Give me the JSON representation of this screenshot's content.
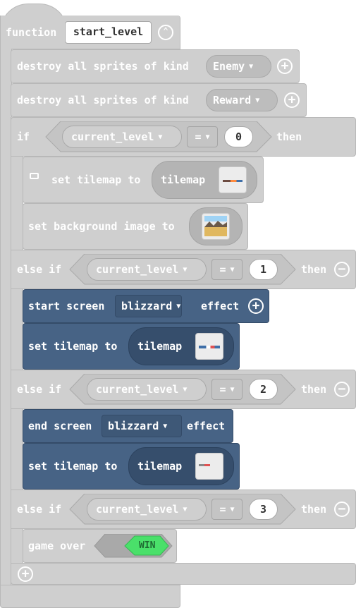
{
  "function": {
    "keyword": "function",
    "name": "start_level",
    "collapse_icon": "chevron-up-icon"
  },
  "destroy_enemy": {
    "label": "destroy all sprites of kind",
    "kind": "Enemy",
    "add_icon": "plus-icon"
  },
  "destroy_reward": {
    "label": "destroy all sprites of kind",
    "kind": "Reward",
    "add_icon": "plus-icon"
  },
  "if_block": {
    "if_label": "if",
    "then_label": "then",
    "else_if_label": "else if",
    "remove_icon": "minus-icon",
    "add_icon": "plus-icon",
    "variable": "current_level",
    "operator": "=",
    "branches": [
      {
        "value": "0"
      },
      {
        "value": "1"
      },
      {
        "value": "2"
      },
      {
        "value": "3"
      }
    ]
  },
  "branch0": {
    "set_tilemap_label": "set tilemap to",
    "tilemap_label": "tilemap",
    "set_background_label": "set background image to"
  },
  "branch1": {
    "start_effect_prefix": "start screen",
    "effect": "blizzard",
    "effect_suffix": "effect",
    "set_tilemap_label": "set tilemap to",
    "tilemap_label": "tilemap"
  },
  "branch2": {
    "end_effect_prefix": "end screen",
    "effect": "blizzard",
    "effect_suffix": "effect",
    "set_tilemap_label": "set tilemap to",
    "tilemap_label": "tilemap"
  },
  "branch3": {
    "game_over_label": "game over",
    "result": "WIN"
  },
  "colors": {
    "function_block": "#cfcfcf",
    "scene_block": "#476385",
    "win_badge": "#4ae06a"
  }
}
